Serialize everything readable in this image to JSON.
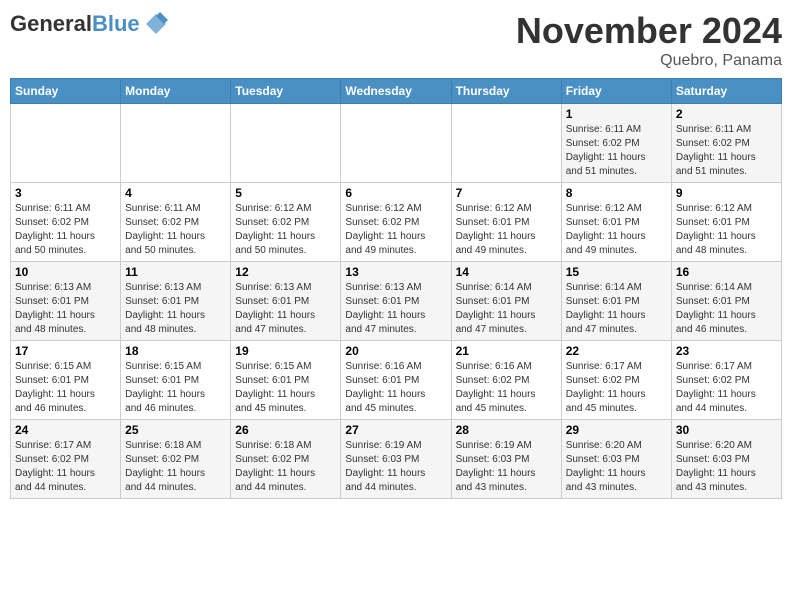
{
  "logo": {
    "general": "General",
    "blue": "Blue"
  },
  "title": {
    "month": "November 2024",
    "location": "Quebro, Panama"
  },
  "days_of_week": [
    "Sunday",
    "Monday",
    "Tuesday",
    "Wednesday",
    "Thursday",
    "Friday",
    "Saturday"
  ],
  "weeks": [
    [
      {
        "day": "",
        "info": ""
      },
      {
        "day": "",
        "info": ""
      },
      {
        "day": "",
        "info": ""
      },
      {
        "day": "",
        "info": ""
      },
      {
        "day": "",
        "info": ""
      },
      {
        "day": "1",
        "info": "Sunrise: 6:11 AM\nSunset: 6:02 PM\nDaylight: 11 hours\nand 51 minutes."
      },
      {
        "day": "2",
        "info": "Sunrise: 6:11 AM\nSunset: 6:02 PM\nDaylight: 11 hours\nand 51 minutes."
      }
    ],
    [
      {
        "day": "3",
        "info": "Sunrise: 6:11 AM\nSunset: 6:02 PM\nDaylight: 11 hours\nand 50 minutes."
      },
      {
        "day": "4",
        "info": "Sunrise: 6:11 AM\nSunset: 6:02 PM\nDaylight: 11 hours\nand 50 minutes."
      },
      {
        "day": "5",
        "info": "Sunrise: 6:12 AM\nSunset: 6:02 PM\nDaylight: 11 hours\nand 50 minutes."
      },
      {
        "day": "6",
        "info": "Sunrise: 6:12 AM\nSunset: 6:02 PM\nDaylight: 11 hours\nand 49 minutes."
      },
      {
        "day": "7",
        "info": "Sunrise: 6:12 AM\nSunset: 6:01 PM\nDaylight: 11 hours\nand 49 minutes."
      },
      {
        "day": "8",
        "info": "Sunrise: 6:12 AM\nSunset: 6:01 PM\nDaylight: 11 hours\nand 49 minutes."
      },
      {
        "day": "9",
        "info": "Sunrise: 6:12 AM\nSunset: 6:01 PM\nDaylight: 11 hours\nand 48 minutes."
      }
    ],
    [
      {
        "day": "10",
        "info": "Sunrise: 6:13 AM\nSunset: 6:01 PM\nDaylight: 11 hours\nand 48 minutes."
      },
      {
        "day": "11",
        "info": "Sunrise: 6:13 AM\nSunset: 6:01 PM\nDaylight: 11 hours\nand 48 minutes."
      },
      {
        "day": "12",
        "info": "Sunrise: 6:13 AM\nSunset: 6:01 PM\nDaylight: 11 hours\nand 47 minutes."
      },
      {
        "day": "13",
        "info": "Sunrise: 6:13 AM\nSunset: 6:01 PM\nDaylight: 11 hours\nand 47 minutes."
      },
      {
        "day": "14",
        "info": "Sunrise: 6:14 AM\nSunset: 6:01 PM\nDaylight: 11 hours\nand 47 minutes."
      },
      {
        "day": "15",
        "info": "Sunrise: 6:14 AM\nSunset: 6:01 PM\nDaylight: 11 hours\nand 47 minutes."
      },
      {
        "day": "16",
        "info": "Sunrise: 6:14 AM\nSunset: 6:01 PM\nDaylight: 11 hours\nand 46 minutes."
      }
    ],
    [
      {
        "day": "17",
        "info": "Sunrise: 6:15 AM\nSunset: 6:01 PM\nDaylight: 11 hours\nand 46 minutes."
      },
      {
        "day": "18",
        "info": "Sunrise: 6:15 AM\nSunset: 6:01 PM\nDaylight: 11 hours\nand 46 minutes."
      },
      {
        "day": "19",
        "info": "Sunrise: 6:15 AM\nSunset: 6:01 PM\nDaylight: 11 hours\nand 45 minutes."
      },
      {
        "day": "20",
        "info": "Sunrise: 6:16 AM\nSunset: 6:01 PM\nDaylight: 11 hours\nand 45 minutes."
      },
      {
        "day": "21",
        "info": "Sunrise: 6:16 AM\nSunset: 6:02 PM\nDaylight: 11 hours\nand 45 minutes."
      },
      {
        "day": "22",
        "info": "Sunrise: 6:17 AM\nSunset: 6:02 PM\nDaylight: 11 hours\nand 45 minutes."
      },
      {
        "day": "23",
        "info": "Sunrise: 6:17 AM\nSunset: 6:02 PM\nDaylight: 11 hours\nand 44 minutes."
      }
    ],
    [
      {
        "day": "24",
        "info": "Sunrise: 6:17 AM\nSunset: 6:02 PM\nDaylight: 11 hours\nand 44 minutes."
      },
      {
        "day": "25",
        "info": "Sunrise: 6:18 AM\nSunset: 6:02 PM\nDaylight: 11 hours\nand 44 minutes."
      },
      {
        "day": "26",
        "info": "Sunrise: 6:18 AM\nSunset: 6:02 PM\nDaylight: 11 hours\nand 44 minutes."
      },
      {
        "day": "27",
        "info": "Sunrise: 6:19 AM\nSunset: 6:03 PM\nDaylight: 11 hours\nand 44 minutes."
      },
      {
        "day": "28",
        "info": "Sunrise: 6:19 AM\nSunset: 6:03 PM\nDaylight: 11 hours\nand 43 minutes."
      },
      {
        "day": "29",
        "info": "Sunrise: 6:20 AM\nSunset: 6:03 PM\nDaylight: 11 hours\nand 43 minutes."
      },
      {
        "day": "30",
        "info": "Sunrise: 6:20 AM\nSunset: 6:03 PM\nDaylight: 11 hours\nand 43 minutes."
      }
    ]
  ]
}
